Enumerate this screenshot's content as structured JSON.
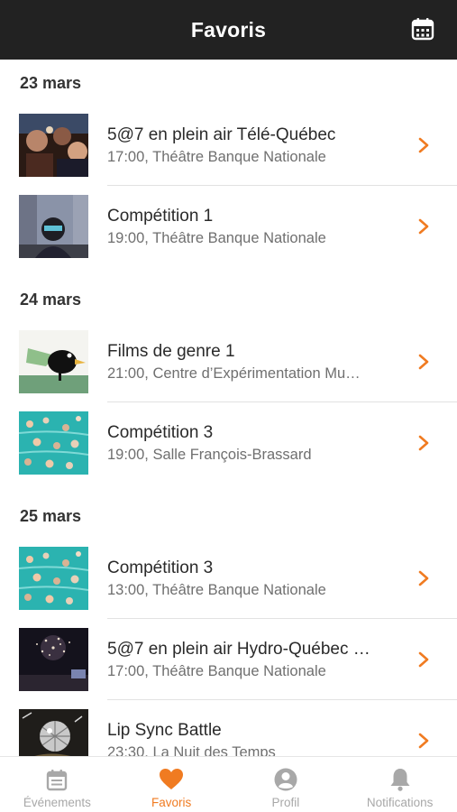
{
  "header": {
    "title": "Favoris",
    "calendar_icon": "calendar-icon"
  },
  "colors": {
    "accent": "#f07b21",
    "topbar": "#222222",
    "muted": "#a8a8a8"
  },
  "sections": [
    {
      "date": "23 mars",
      "items": [
        {
          "name": "5@7 en plein air Télé-Québec",
          "meta": "17:00, Théâtre Banque Nationale",
          "thumb": "crowd-night"
        },
        {
          "name": "Compétition 1",
          "meta": "19:00, Théâtre Banque Nationale",
          "thumb": "street-masked-figure"
        }
      ]
    },
    {
      "date": "24 mars",
      "items": [
        {
          "name": "Films de genre 1",
          "meta": "21:00, Centre d’Expérimentation Mu…",
          "thumb": "cartoon-bird"
        },
        {
          "name": "Compétition 3",
          "meta": "19:00, Salle François-Brassard",
          "thumb": "swimmers-pool"
        }
      ]
    },
    {
      "date": "25 mars",
      "items": [
        {
          "name": "Compétition 3",
          "meta": "13:00, Théâtre Banque Nationale",
          "thumb": "swimmers-pool"
        },
        {
          "name": "5@7 en plein air Hydro-Québec …",
          "meta": "17:00, Théâtre Banque Nationale",
          "thumb": "fireworks-night"
        },
        {
          "name": "Lip Sync Battle",
          "meta": "23:30, La Nuit des Temps",
          "thumb": "mirrorball"
        }
      ]
    }
  ],
  "tabs": [
    {
      "label": "Événements",
      "icon": "event-icon",
      "active": false
    },
    {
      "label": "Favoris",
      "icon": "heart-icon",
      "active": true
    },
    {
      "label": "Profil",
      "icon": "profile-icon",
      "active": false
    },
    {
      "label": "Notifications",
      "icon": "bell-icon",
      "active": false
    }
  ]
}
